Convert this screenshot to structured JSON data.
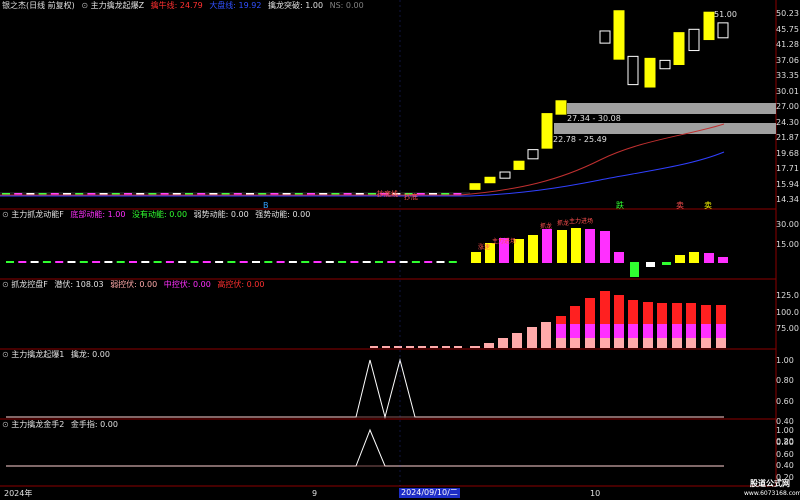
{
  "panels": {
    "p1": {
      "title": "银之杰(日线 前复权)",
      "ind_dot": "⊙",
      "ind_title": "主力擒龙起爆Z",
      "items": [
        {
          "text": "擒牛线: 24.79",
          "color": "#ff3030"
        },
        {
          "text": "大盘线: 19.92",
          "color": "#3050ff"
        },
        {
          "text": "擒龙突破: 1.00",
          "color": "#e0e0e0"
        },
        {
          "text": "NS: 0.00",
          "color": "#808080"
        }
      ]
    },
    "p2": {
      "title": "主力抓龙动能F",
      "items": [
        {
          "text": "底部动能: 1.00",
          "color": "#ff30ff"
        },
        {
          "text": "没有动能: 0.00",
          "color": "#30ff30"
        },
        {
          "text": "弱势动能: 0.00",
          "color": "#e0e0e0"
        },
        {
          "text": "强势动能: 0.00",
          "color": "#e0e0e0"
        }
      ]
    },
    "p3": {
      "title": "抓龙控盘F",
      "items": [
        {
          "text": "潜伏: 108.03",
          "color": "#e0e0e0"
        },
        {
          "text": "弱控伏: 0.00",
          "color": "#ffaaaa"
        },
        {
          "text": "中控伏: 0.00",
          "color": "#ff30ff"
        },
        {
          "text": "高控伏: 0.00",
          "color": "#ff3030"
        }
      ]
    },
    "p4": {
      "title": "主力擒龙起爆1",
      "items": [
        {
          "text": "擒龙: 0.00",
          "color": "#e0e0e0"
        }
      ]
    },
    "p5": {
      "title": "主力擒龙金手2",
      "items": [
        {
          "text": "金手指: 0.00",
          "color": "#e0e0e0"
        }
      ]
    }
  },
  "axes": {
    "p1": [
      "50.23",
      "45.75",
      "41.28",
      "37.06",
      "33.35",
      "30.01",
      "27.00",
      "24.30",
      "21.87",
      "19.68",
      "17.71",
      "15.94",
      "14.34"
    ],
    "p2": [
      "30.00",
      "15.00"
    ],
    "p3": [
      "125.0",
      "100.0",
      "75.00"
    ],
    "p4": [
      "1.00",
      "0.80",
      "0.60",
      "0.40",
      "0.20"
    ],
    "p5": [
      "1.00",
      "0.80",
      "0.60",
      "0.40",
      "0.20"
    ]
  },
  "annotations": {
    "high_price": "51.00",
    "zone_upper": "27.34 - 30.08",
    "zone_lower": "22.78 - 25.49",
    "sig_buy": "跌",
    "sig_sell1": "卖",
    "sig_sell2": "卖",
    "sig_low": "B",
    "p2_tags": [
      "涨速",
      "主力进场",
      "抓龙",
      "抓龙",
      "主力进场"
    ],
    "p1_tags": [
      "抄底线",
      "抄底"
    ]
  },
  "timebar": {
    "year": "2024年",
    "month_9": "9",
    "cursor_date": "2024/09/10/二",
    "month_10": "10"
  },
  "watermark": {
    "line1": "股道公式网",
    "line2": "www.6073168.com"
  },
  "colors": {
    "up": "#ffff00",
    "down": "#ffffff",
    "bg": "#000000",
    "grid": "#8b0000"
  }
}
